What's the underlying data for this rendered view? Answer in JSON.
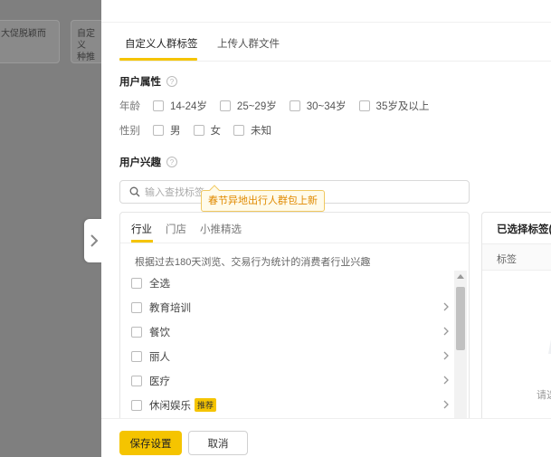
{
  "background": {
    "card1_text": "大促脱颖而",
    "card2_line1": "自定义",
    "card2_line2": "种推广"
  },
  "tabs": {
    "custom": "自定义人群标签",
    "upload": "上传人群文件"
  },
  "user_attributes": {
    "title": "用户属性",
    "help": "?",
    "age": {
      "label": "年龄",
      "options": [
        "14-24岁",
        "25~29岁",
        "30~34岁",
        "35岁及以上"
      ]
    },
    "gender": {
      "label": "性别",
      "options": [
        "男",
        "女",
        "未知"
      ]
    }
  },
  "user_interest": {
    "title": "用户兴趣",
    "help": "?",
    "search_placeholder": "输入查找标签",
    "tooltip": "春节异地出行人群包上新",
    "panel_tabs": [
      "行业",
      "门店",
      "小推精选"
    ],
    "description": "根据过去180天浏览、交易行为统计的消费者行业兴趣",
    "items": [
      {
        "label": "全选",
        "badge": ""
      },
      {
        "label": "教育培训",
        "badge": ""
      },
      {
        "label": "餐饮",
        "badge": ""
      },
      {
        "label": "丽人",
        "badge": ""
      },
      {
        "label": "医疗",
        "badge": ""
      },
      {
        "label": "休闲娱乐",
        "badge": "推荐"
      }
    ]
  },
  "selected_panel": {
    "title": "已选择标签(",
    "column": "标签",
    "empty": "请选"
  },
  "footer": {
    "save": "保存设置",
    "cancel": "取消"
  },
  "colors": {
    "accent": "#f5c400",
    "tooltip_text": "#e08a00",
    "overlay": "#7f7f7f"
  }
}
